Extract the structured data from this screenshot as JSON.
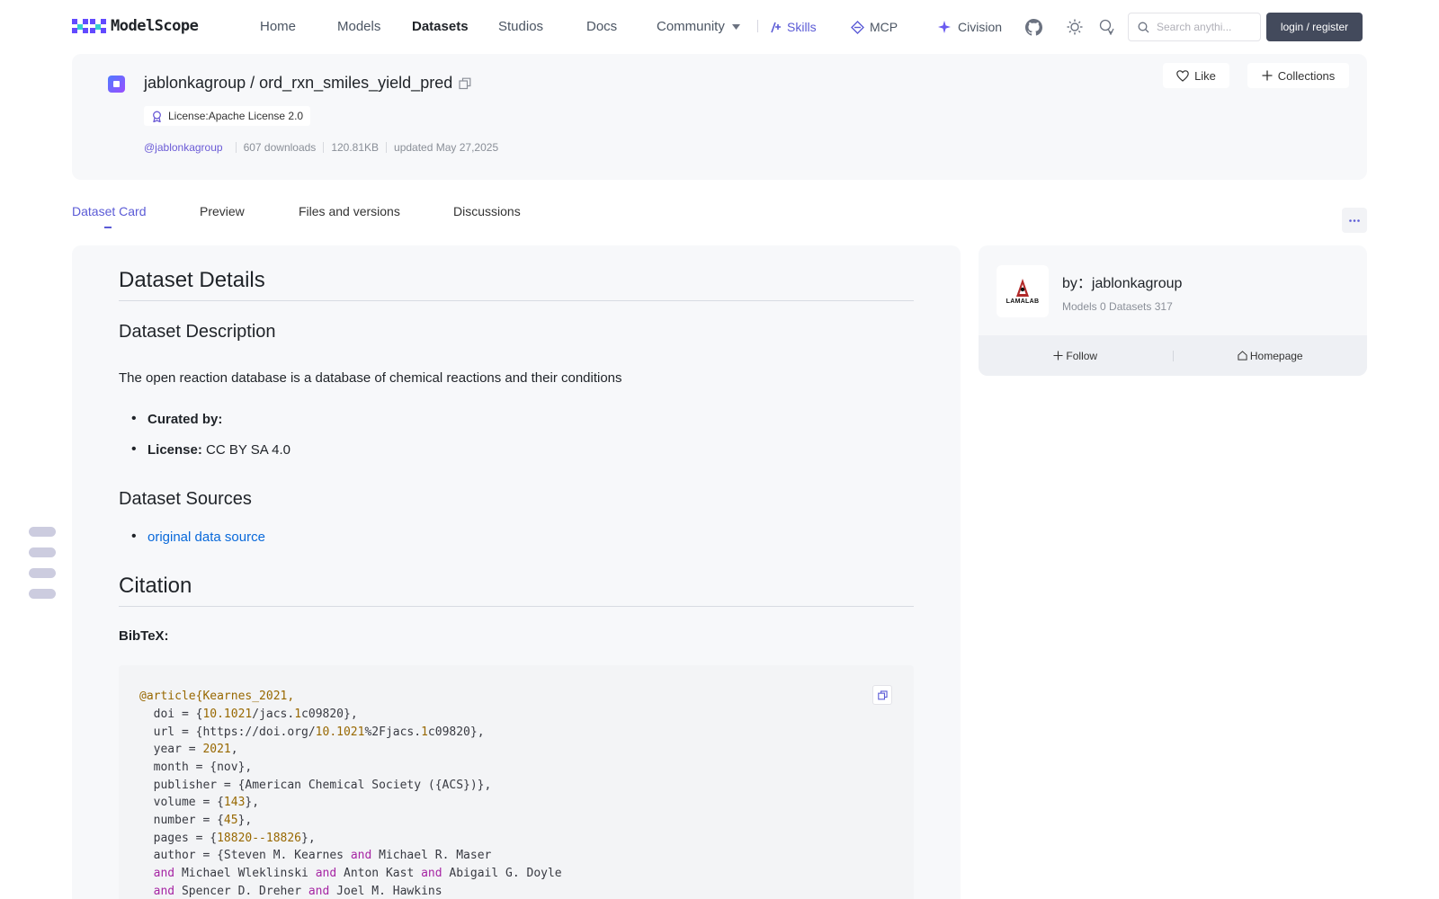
{
  "brand": {
    "name": "ModelScope",
    "accent": "#5b5bd6"
  },
  "nav": {
    "home": "Home",
    "models": "Models",
    "datasets": "Datasets",
    "studios": "Studios",
    "docs": "Docs",
    "community": "Community",
    "skills": "Skills",
    "mcp": "MCP",
    "civision": "Civision",
    "search_placeholder": "Search anythi...",
    "login": "login / register"
  },
  "repo": {
    "owner": "jablonkagroup",
    "separator": "/",
    "name": "ord_rxn_smiles_yield_pred",
    "license": "License:Apache License 2.0",
    "author_handle": "@jablonkagroup",
    "downloads": "607 downloads",
    "size": "120.81KB",
    "updated": "updated May 27,2025",
    "like_label": "Like",
    "collections_label": "Collections"
  },
  "tabs": [
    "Dataset Card",
    "Preview",
    "Files and versions",
    "Discussions"
  ],
  "card": {
    "h_details": "Dataset Details",
    "h_description": "Dataset Description",
    "description": "The open reaction database is a database of chemical reactions and their conditions",
    "curated_label": "Curated by:",
    "license_label": "License:",
    "license_value": "CC BY SA 4.0",
    "h_sources": "Dataset Sources",
    "source_link": "original data source",
    "h_citation": "Citation",
    "bibtex_label": "BibTeX:"
  },
  "bibtex": {
    "entry": "@article{Kearnes_2021,",
    "doi_pre": "  doi = {",
    "doi_num": "10.1021",
    "doi_mid": "/jacs.",
    "doi_num2": "1",
    "doi_post": "c09820},",
    "url_pre": "  url = {https://doi.org/",
    "url_num": "10.1021",
    "url_mid": "%2Fjacs.",
    "url_num2": "1",
    "url_post": "c09820},",
    "year_pre": "  year = ",
    "year_num": "2021",
    "year_post": ",",
    "month": "  month = {nov},",
    "publisher": "  publisher = {American Chemical Society ({ACS})},",
    "volume_pre": "  volume = {",
    "volume_num": "143",
    "volume_post": "},",
    "number_pre": "  number = {",
    "number_num": "45",
    "number_post": "},",
    "pages_pre": "  pages = {",
    "pages_num": "18820--18826",
    "pages_post": "},",
    "author1_pre": "  author = {Steven M. Kearnes ",
    "kw_and": "and",
    "author1_post": " Michael R. Maser",
    "author2_a": " Michael Wleklinski ",
    "author2_b": " Anton Kast ",
    "author2_c": " Abigail G. Doyle",
    "author3_a": " Spencer D. Dreher ",
    "author3_b": " Joel M. Hawkins"
  },
  "org": {
    "logo_text": "LAMALAB",
    "by_label": "by：jablonkagroup",
    "stats": "Models 0  Datasets 317",
    "follow": "Follow",
    "homepage": "Homepage"
  }
}
